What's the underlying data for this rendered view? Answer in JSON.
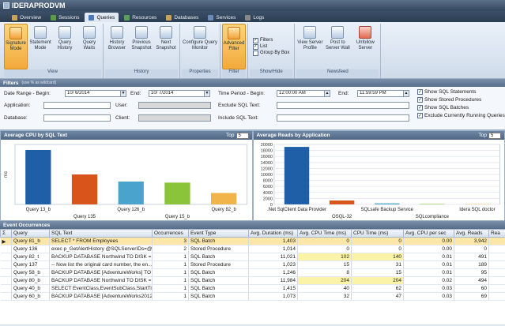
{
  "app": {
    "title": "IDERAPRODVM"
  },
  "tabs": [
    {
      "label": "Overview",
      "color": "#c9a35a"
    },
    {
      "label": "Sessions",
      "color": "#5a9a4a"
    },
    {
      "label": "Queries",
      "color": "#4a78b8"
    },
    {
      "label": "Resources",
      "color": "#5aa05a"
    },
    {
      "label": "Databases",
      "color": "#c9a35a"
    },
    {
      "label": "Services",
      "color": "#6a8ab8"
    },
    {
      "label": "Logs",
      "color": "#888888"
    }
  ],
  "ribbon": {
    "view": {
      "label": "View",
      "buttons": [
        "Signature Mode",
        "Statement Mode",
        "Query History",
        "Query Waits"
      ]
    },
    "history": {
      "label": "History",
      "buttons": [
        "History Browser",
        "Previous Snapshot",
        "Next Snapshot"
      ]
    },
    "properties": {
      "label": "Properties",
      "buttons": [
        "Configure Query Monitor"
      ]
    },
    "filter": {
      "label": "Filter",
      "buttons": [
        "Advanced Filter"
      ]
    },
    "showhide": {
      "label": "Show/Hide",
      "checks": [
        {
          "label": "Filters",
          "checked": true
        },
        {
          "label": "List",
          "checked": true
        },
        {
          "label": "Group By Box",
          "checked": false
        }
      ]
    },
    "newsfeed": {
      "label": "Newsfeed",
      "buttons": [
        "View Server Profile",
        "Post to Server Wall",
        "Unfollow Server"
      ]
    }
  },
  "filters": {
    "header": "Filters",
    "sub": "(use % as wildcard)",
    "date_begin_label": "Date Range - Begin:",
    "date_begin": "10/ 6/2014",
    "end_label": "End:",
    "date_end": "10/ 7/2014",
    "time_begin_label": "Time Period - Begin:",
    "time_begin": "12:00:00 AM",
    "time_end_label": "End:",
    "time_end": "11:59:59 PM",
    "application_label": "Application:",
    "user_label": "User:",
    "exclude_sql_label": "Exclude SQL Text:",
    "database_label": "Database:",
    "client_label": "Client:",
    "include_sql_label": "Include SQL Text:",
    "options": [
      {
        "label": "Show SQL Statements",
        "checked": true
      },
      {
        "label": "Show Stored Procedures",
        "checked": true
      },
      {
        "label": "Show SQL Batches",
        "checked": true
      },
      {
        "label": "Exclude Currently Running Queries",
        "checked": true
      }
    ]
  },
  "chart_data": [
    {
      "type": "bar",
      "title": "Average CPU",
      "by": "by SQL Text",
      "top_label": "Top",
      "top_value": "5",
      "ylabel": "ms",
      "categories": [
        "Query 13_b",
        "Query 135",
        "Query 126_b",
        "Query 15_b",
        "Query 82_b"
      ],
      "values": [
        1000,
        550,
        420,
        400,
        210
      ],
      "colors": [
        "#1f5fa8",
        "#d9541b",
        "#4aa3cc",
        "#8ac43a",
        "#f0b44b"
      ],
      "ylim": [
        0,
        1100
      ],
      "legend": "none"
    },
    {
      "type": "bar",
      "title": "Average Reads",
      "by": "by Application",
      "top_label": "Top",
      "top_value": "5",
      "ylabel": "",
      "categories": [
        ".Net SqlClient Data Provider",
        "OSQL-32",
        "SQLsafe Backup Service",
        "SQLcompliance",
        "Idera SQL doctor"
      ],
      "values": [
        19200,
        1300,
        350,
        150,
        100
      ],
      "colors": [
        "#1f5fa8",
        "#d9541b",
        "#4aa3cc",
        "#8ac43a",
        "#f0b44b"
      ],
      "ylim": [
        0,
        20000
      ],
      "yticks": [
        0,
        2000,
        4000,
        6000,
        8000,
        10000,
        12000,
        14000,
        16000,
        18000,
        20000
      ],
      "legend": "none"
    }
  ],
  "events": {
    "header": "Event Occurrences",
    "columns": [
      "Query",
      "SQL Text",
      "Occurrences",
      "Event Type",
      "Avg. Duration (ms)",
      "Avg. CPU Time (ms)",
      "CPU Time (ms)",
      "Avg. CPU per sec",
      "Avg. Reads",
      "Rea"
    ],
    "rows": [
      [
        "Query 81_b",
        "SELECT * FROM Employees",
        "3",
        "SQL Batch",
        "1,403",
        "0",
        "0",
        "0.00",
        "3,942",
        ""
      ],
      [
        "Query 136",
        "exec p_GetAlertHistory @SQLServerIDs=@...",
        "2",
        "Stored Procedure",
        "1,014",
        "0",
        "0",
        "0.00",
        "0",
        ""
      ],
      [
        "Query 82_t",
        "BACKUP DATABASE Northwind TO DISK = #",
        "1",
        "SQL Batch",
        "11,021",
        "102",
        "140",
        "0.01",
        "491",
        ""
      ],
      [
        "Query 137",
        "-- Now list the original card number, the en...",
        "1",
        "Stored Procedure",
        "1,023",
        "15",
        "31",
        "0.01",
        "189",
        ""
      ],
      [
        "Query 58_b",
        "BACKUP DATABASE [AdventureWorks] TO VI...",
        "1",
        "SQL Batch",
        "1,246",
        "8",
        "15",
        "0.01",
        "95",
        ""
      ],
      [
        "Query 80_b",
        "BACKUP DATABASE Northwind TO DISK = #",
        "1",
        "SQL Batch",
        "11,984",
        "204",
        "204",
        "0.02",
        "494",
        ""
      ],
      [
        "Query 40_b",
        "SELECT EventClass,EventSubClass,StartTime,S...",
        "1",
        "SQL Batch",
        "1,415",
        "40",
        "62",
        "0.03",
        "60",
        ""
      ],
      [
        "Query 60_b",
        "BACKUP DATABASE [AdventureWorks2012] TO...",
        "1",
        "SQL Batch",
        "1,073",
        "32",
        "47",
        "0.03",
        "69",
        ""
      ]
    ]
  }
}
